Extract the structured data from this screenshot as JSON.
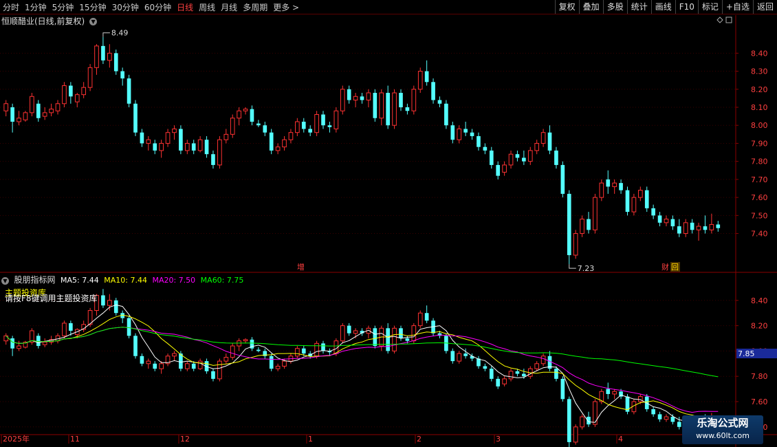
{
  "toolbar": {
    "periods": [
      "分时",
      "1分钟",
      "5分钟",
      "15分钟",
      "30分钟",
      "60分钟",
      "日线",
      "周线",
      "月线",
      "多周期",
      "更多 >"
    ],
    "active_period": "日线",
    "right_buttons": [
      "复权",
      "叠加",
      "多股",
      "统计",
      "画线",
      "F10",
      "标记",
      "+自选",
      "返回"
    ]
  },
  "stock": {
    "title": "恒顺醋业(日线,前复权)",
    "high_label": "8.49",
    "low_label": "7.23",
    "marker_zeng": "增",
    "marker_caihui": "财",
    "marker_hui": "回"
  },
  "indicator": {
    "name": "股朋指标网",
    "ma5": "MA5: 7.44",
    "ma10": "MA10: 7.44",
    "ma20": "MA20: 7.50",
    "ma60": "MA60: 7.75",
    "overlay1": "主题投资库",
    "overlay2": "请按F8键调用主题投资库",
    "current_price_tag": "7.85"
  },
  "colors": {
    "up": "#ff3232",
    "down": "#54ffff",
    "ma5": "#ffffff",
    "ma10": "#ffff00",
    "ma20": "#ff00ff",
    "ma60": "#00ff00",
    "axis": "#8b0000"
  },
  "axis": {
    "top_ticks": [
      "8.40",
      "8.30",
      "8.20",
      "8.10",
      "8.00",
      "7.90",
      "7.80",
      "7.70",
      "7.60",
      "7.50",
      "7.40"
    ],
    "bottom_ticks": [
      "8.40",
      "8.20",
      "8.00",
      "7.80",
      "7.60",
      "7.40"
    ],
    "x_labels": [
      "2025年",
      "11",
      "12",
      "1",
      "2",
      "3",
      "4"
    ]
  },
  "watermark": {
    "line1": "乐淘公式网",
    "line2": "www.60lt.com"
  },
  "chart_data": {
    "type": "candlestick",
    "title": "恒顺醋业(日线,前复权)",
    "x_axis": [
      "2025年",
      "11",
      "12",
      "1",
      "2",
      "3",
      "4"
    ],
    "ylim_top": [
      7.2,
      8.55
    ],
    "ylim_bottom": [
      7.35,
      8.6
    ],
    "candles": [
      {
        "o": 8.08,
        "h": 8.14,
        "l": 8.05,
        "c": 8.12
      },
      {
        "o": 8.1,
        "h": 8.12,
        "l": 7.96,
        "c": 8.02
      },
      {
        "o": 8.02,
        "h": 8.08,
        "l": 8.0,
        "c": 8.04
      },
      {
        "o": 8.03,
        "h": 8.08,
        "l": 8.02,
        "c": 8.07
      },
      {
        "o": 8.07,
        "h": 8.18,
        "l": 8.05,
        "c": 8.16
      },
      {
        "o": 8.12,
        "h": 8.14,
        "l": 8.02,
        "c": 8.04
      },
      {
        "o": 8.05,
        "h": 8.1,
        "l": 8.03,
        "c": 8.07
      },
      {
        "o": 8.07,
        "h": 8.12,
        "l": 8.05,
        "c": 8.09
      },
      {
        "o": 8.08,
        "h": 8.14,
        "l": 8.06,
        "c": 8.12
      },
      {
        "o": 8.12,
        "h": 8.24,
        "l": 8.1,
        "c": 8.22
      },
      {
        "o": 8.22,
        "h": 8.24,
        "l": 8.12,
        "c": 8.16
      },
      {
        "o": 8.13,
        "h": 8.18,
        "l": 8.1,
        "c": 8.17
      },
      {
        "o": 8.17,
        "h": 8.24,
        "l": 8.15,
        "c": 8.21
      },
      {
        "o": 8.21,
        "h": 8.34,
        "l": 8.19,
        "c": 8.32
      },
      {
        "o": 8.32,
        "h": 8.45,
        "l": 8.28,
        "c": 8.44
      },
      {
        "o": 8.44,
        "h": 8.49,
        "l": 8.34,
        "c": 8.36
      },
      {
        "o": 8.36,
        "h": 8.45,
        "l": 8.32,
        "c": 8.4
      },
      {
        "o": 8.4,
        "h": 8.42,
        "l": 8.28,
        "c": 8.3
      },
      {
        "o": 8.3,
        "h": 8.32,
        "l": 8.22,
        "c": 8.26
      },
      {
        "o": 8.26,
        "h": 8.28,
        "l": 8.1,
        "c": 8.12
      },
      {
        "o": 8.12,
        "h": 8.14,
        "l": 7.94,
        "c": 7.96
      },
      {
        "o": 7.96,
        "h": 7.98,
        "l": 7.88,
        "c": 7.9
      },
      {
        "o": 7.9,
        "h": 7.94,
        "l": 7.86,
        "c": 7.92
      },
      {
        "o": 7.9,
        "h": 7.92,
        "l": 7.84,
        "c": 7.86
      },
      {
        "o": 7.86,
        "h": 7.92,
        "l": 7.82,
        "c": 7.9
      },
      {
        "o": 7.9,
        "h": 7.98,
        "l": 7.88,
        "c": 7.96
      },
      {
        "o": 7.96,
        "h": 8.0,
        "l": 7.92,
        "c": 7.98
      },
      {
        "o": 7.98,
        "h": 8.0,
        "l": 7.84,
        "c": 7.86
      },
      {
        "o": 7.86,
        "h": 7.92,
        "l": 7.84,
        "c": 7.9
      },
      {
        "o": 7.9,
        "h": 7.92,
        "l": 7.84,
        "c": 7.86
      },
      {
        "o": 7.86,
        "h": 7.94,
        "l": 7.85,
        "c": 7.92
      },
      {
        "o": 7.92,
        "h": 7.94,
        "l": 7.82,
        "c": 7.84
      },
      {
        "o": 7.84,
        "h": 7.86,
        "l": 7.76,
        "c": 7.78
      },
      {
        "o": 7.78,
        "h": 7.94,
        "l": 7.76,
        "c": 7.92
      },
      {
        "o": 7.92,
        "h": 7.98,
        "l": 7.9,
        "c": 7.95
      },
      {
        "o": 7.95,
        "h": 8.06,
        "l": 7.93,
        "c": 8.04
      },
      {
        "o": 8.04,
        "h": 8.1,
        "l": 8.0,
        "c": 8.08
      },
      {
        "o": 8.08,
        "h": 8.1,
        "l": 8.06,
        "c": 8.09
      },
      {
        "o": 8.09,
        "h": 8.11,
        "l": 8.0,
        "c": 8.02
      },
      {
        "o": 8.01,
        "h": 8.03,
        "l": 7.99,
        "c": 8.0
      },
      {
        "o": 8.0,
        "h": 8.02,
        "l": 7.94,
        "c": 7.96
      },
      {
        "o": 7.96,
        "h": 7.98,
        "l": 7.84,
        "c": 7.86
      },
      {
        "o": 7.86,
        "h": 7.9,
        "l": 7.84,
        "c": 7.88
      },
      {
        "o": 7.88,
        "h": 7.94,
        "l": 7.86,
        "c": 7.92
      },
      {
        "o": 7.92,
        "h": 7.98,
        "l": 7.9,
        "c": 7.96
      },
      {
        "o": 7.96,
        "h": 8.04,
        "l": 7.94,
        "c": 8.02
      },
      {
        "o": 8.02,
        "h": 8.04,
        "l": 7.96,
        "c": 7.98
      },
      {
        "o": 7.98,
        "h": 8.0,
        "l": 7.94,
        "c": 7.96
      },
      {
        "o": 7.96,
        "h": 8.08,
        "l": 7.94,
        "c": 8.06
      },
      {
        "o": 8.06,
        "h": 8.08,
        "l": 7.98,
        "c": 8.0
      },
      {
        "o": 8.0,
        "h": 8.02,
        "l": 7.96,
        "c": 7.99
      },
      {
        "o": 7.98,
        "h": 8.1,
        "l": 7.96,
        "c": 8.08
      },
      {
        "o": 8.08,
        "h": 8.22,
        "l": 8.06,
        "c": 8.2
      },
      {
        "o": 8.2,
        "h": 8.22,
        "l": 8.12,
        "c": 8.14
      },
      {
        "o": 8.14,
        "h": 8.18,
        "l": 8.1,
        "c": 8.16
      },
      {
        "o": 8.16,
        "h": 8.18,
        "l": 8.12,
        "c": 8.14
      },
      {
        "o": 8.14,
        "h": 8.2,
        "l": 8.1,
        "c": 8.18
      },
      {
        "o": 8.18,
        "h": 8.2,
        "l": 8.02,
        "c": 8.04
      },
      {
        "o": 8.04,
        "h": 8.2,
        "l": 8.0,
        "c": 8.18
      },
      {
        "o": 8.18,
        "h": 8.22,
        "l": 7.98,
        "c": 8.0
      },
      {
        "o": 8.0,
        "h": 8.2,
        "l": 7.98,
        "c": 8.18
      },
      {
        "o": 8.18,
        "h": 8.2,
        "l": 8.08,
        "c": 8.1
      },
      {
        "o": 8.1,
        "h": 8.12,
        "l": 8.06,
        "c": 8.08
      },
      {
        "o": 8.08,
        "h": 8.22,
        "l": 8.06,
        "c": 8.2
      },
      {
        "o": 8.2,
        "h": 8.32,
        "l": 8.18,
        "c": 8.3
      },
      {
        "o": 8.3,
        "h": 8.36,
        "l": 8.22,
        "c": 8.24
      },
      {
        "o": 8.24,
        "h": 8.26,
        "l": 8.12,
        "c": 8.14
      },
      {
        "o": 8.14,
        "h": 8.16,
        "l": 8.1,
        "c": 8.12
      },
      {
        "o": 8.12,
        "h": 8.14,
        "l": 7.98,
        "c": 8.0
      },
      {
        "o": 8.0,
        "h": 8.02,
        "l": 7.9,
        "c": 7.92
      },
      {
        "o": 7.92,
        "h": 8.0,
        "l": 7.9,
        "c": 7.98
      },
      {
        "o": 7.98,
        "h": 8.02,
        "l": 7.94,
        "c": 7.96
      },
      {
        "o": 7.96,
        "h": 7.98,
        "l": 7.92,
        "c": 7.94
      },
      {
        "o": 7.94,
        "h": 7.96,
        "l": 7.86,
        "c": 7.88
      },
      {
        "o": 7.88,
        "h": 7.9,
        "l": 7.84,
        "c": 7.86
      },
      {
        "o": 7.86,
        "h": 7.88,
        "l": 7.76,
        "c": 7.78
      },
      {
        "o": 7.78,
        "h": 7.8,
        "l": 7.7,
        "c": 7.72
      },
      {
        "o": 7.74,
        "h": 7.8,
        "l": 7.72,
        "c": 7.78
      },
      {
        "o": 7.78,
        "h": 7.86,
        "l": 7.76,
        "c": 7.84
      },
      {
        "o": 7.84,
        "h": 7.86,
        "l": 7.8,
        "c": 7.82
      },
      {
        "o": 7.82,
        "h": 7.86,
        "l": 7.78,
        "c": 7.8
      },
      {
        "o": 7.8,
        "h": 7.88,
        "l": 7.78,
        "c": 7.86
      },
      {
        "o": 7.86,
        "h": 7.92,
        "l": 7.84,
        "c": 7.9
      },
      {
        "o": 7.9,
        "h": 7.98,
        "l": 7.88,
        "c": 7.96
      },
      {
        "o": 7.96,
        "h": 8.0,
        "l": 7.84,
        "c": 7.86
      },
      {
        "o": 7.86,
        "h": 7.88,
        "l": 7.76,
        "c": 7.78
      },
      {
        "o": 7.78,
        "h": 7.8,
        "l": 7.6,
        "c": 7.62
      },
      {
        "o": 7.62,
        "h": 7.64,
        "l": 7.23,
        "c": 7.28
      },
      {
        "o": 7.28,
        "h": 7.42,
        "l": 7.26,
        "c": 7.4
      },
      {
        "o": 7.4,
        "h": 7.5,
        "l": 7.38,
        "c": 7.48
      },
      {
        "o": 7.48,
        "h": 7.52,
        "l": 7.4,
        "c": 7.42
      },
      {
        "o": 7.42,
        "h": 7.62,
        "l": 7.4,
        "c": 7.6
      },
      {
        "o": 7.6,
        "h": 7.7,
        "l": 7.58,
        "c": 7.68
      },
      {
        "o": 7.7,
        "h": 7.75,
        "l": 7.62,
        "c": 7.66
      },
      {
        "o": 7.66,
        "h": 7.7,
        "l": 7.62,
        "c": 7.68
      },
      {
        "o": 7.68,
        "h": 7.7,
        "l": 7.62,
        "c": 7.64
      },
      {
        "o": 7.64,
        "h": 7.66,
        "l": 7.5,
        "c": 7.52
      },
      {
        "o": 7.52,
        "h": 7.62,
        "l": 7.5,
        "c": 7.6
      },
      {
        "o": 7.6,
        "h": 7.66,
        "l": 7.58,
        "c": 7.64
      },
      {
        "o": 7.64,
        "h": 7.66,
        "l": 7.52,
        "c": 7.54
      },
      {
        "o": 7.54,
        "h": 7.56,
        "l": 7.48,
        "c": 7.5
      },
      {
        "o": 7.5,
        "h": 7.52,
        "l": 7.44,
        "c": 7.46
      },
      {
        "o": 7.46,
        "h": 7.5,
        "l": 7.44,
        "c": 7.48
      },
      {
        "o": 7.48,
        "h": 7.5,
        "l": 7.42,
        "c": 7.44
      },
      {
        "o": 7.44,
        "h": 7.48,
        "l": 7.38,
        "c": 7.4
      },
      {
        "o": 7.4,
        "h": 7.48,
        "l": 7.38,
        "c": 7.46
      },
      {
        "o": 7.46,
        "h": 7.48,
        "l": 7.4,
        "c": 7.42
      },
      {
        "o": 7.42,
        "h": 7.46,
        "l": 7.36,
        "c": 7.44
      },
      {
        "o": 7.44,
        "h": 7.5,
        "l": 7.4,
        "c": 7.42
      },
      {
        "o": 7.42,
        "h": 7.51,
        "l": 7.4,
        "c": 7.45
      },
      {
        "o": 7.45,
        "h": 7.47,
        "l": 7.41,
        "c": 7.43
      }
    ],
    "ma_series": [
      {
        "name": "MA5",
        "last": 7.44
      },
      {
        "name": "MA10",
        "last": 7.44
      },
      {
        "name": "MA20",
        "last": 7.5
      },
      {
        "name": "MA60",
        "last": 7.75
      }
    ]
  }
}
